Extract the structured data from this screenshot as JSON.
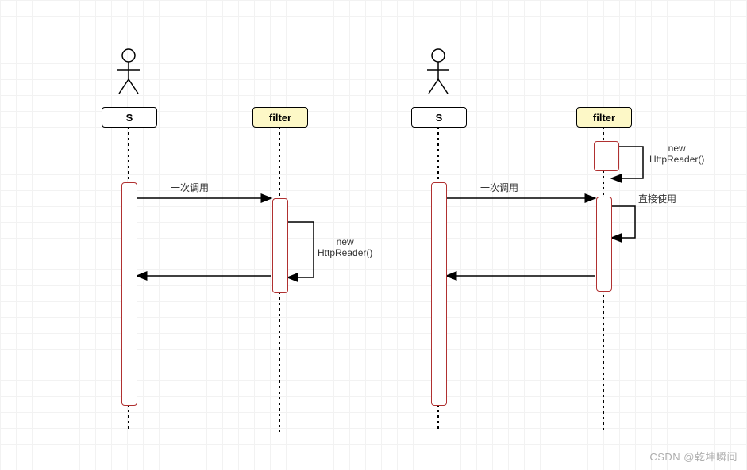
{
  "diagram": {
    "left": {
      "actor_label": "S",
      "filter_label": "filter",
      "call_label": "一次调用",
      "self_call_label_line1": "new",
      "self_call_label_line2": "HttpReader()"
    },
    "right": {
      "actor_label": "S",
      "filter_label": "filter",
      "call_label": "一次调用",
      "direct_use_label": "直接使用",
      "self_call_label_line1": "new",
      "self_call_label_line2": "HttpReader()"
    }
  },
  "watermark": "CSDN @乾坤瞬间"
}
